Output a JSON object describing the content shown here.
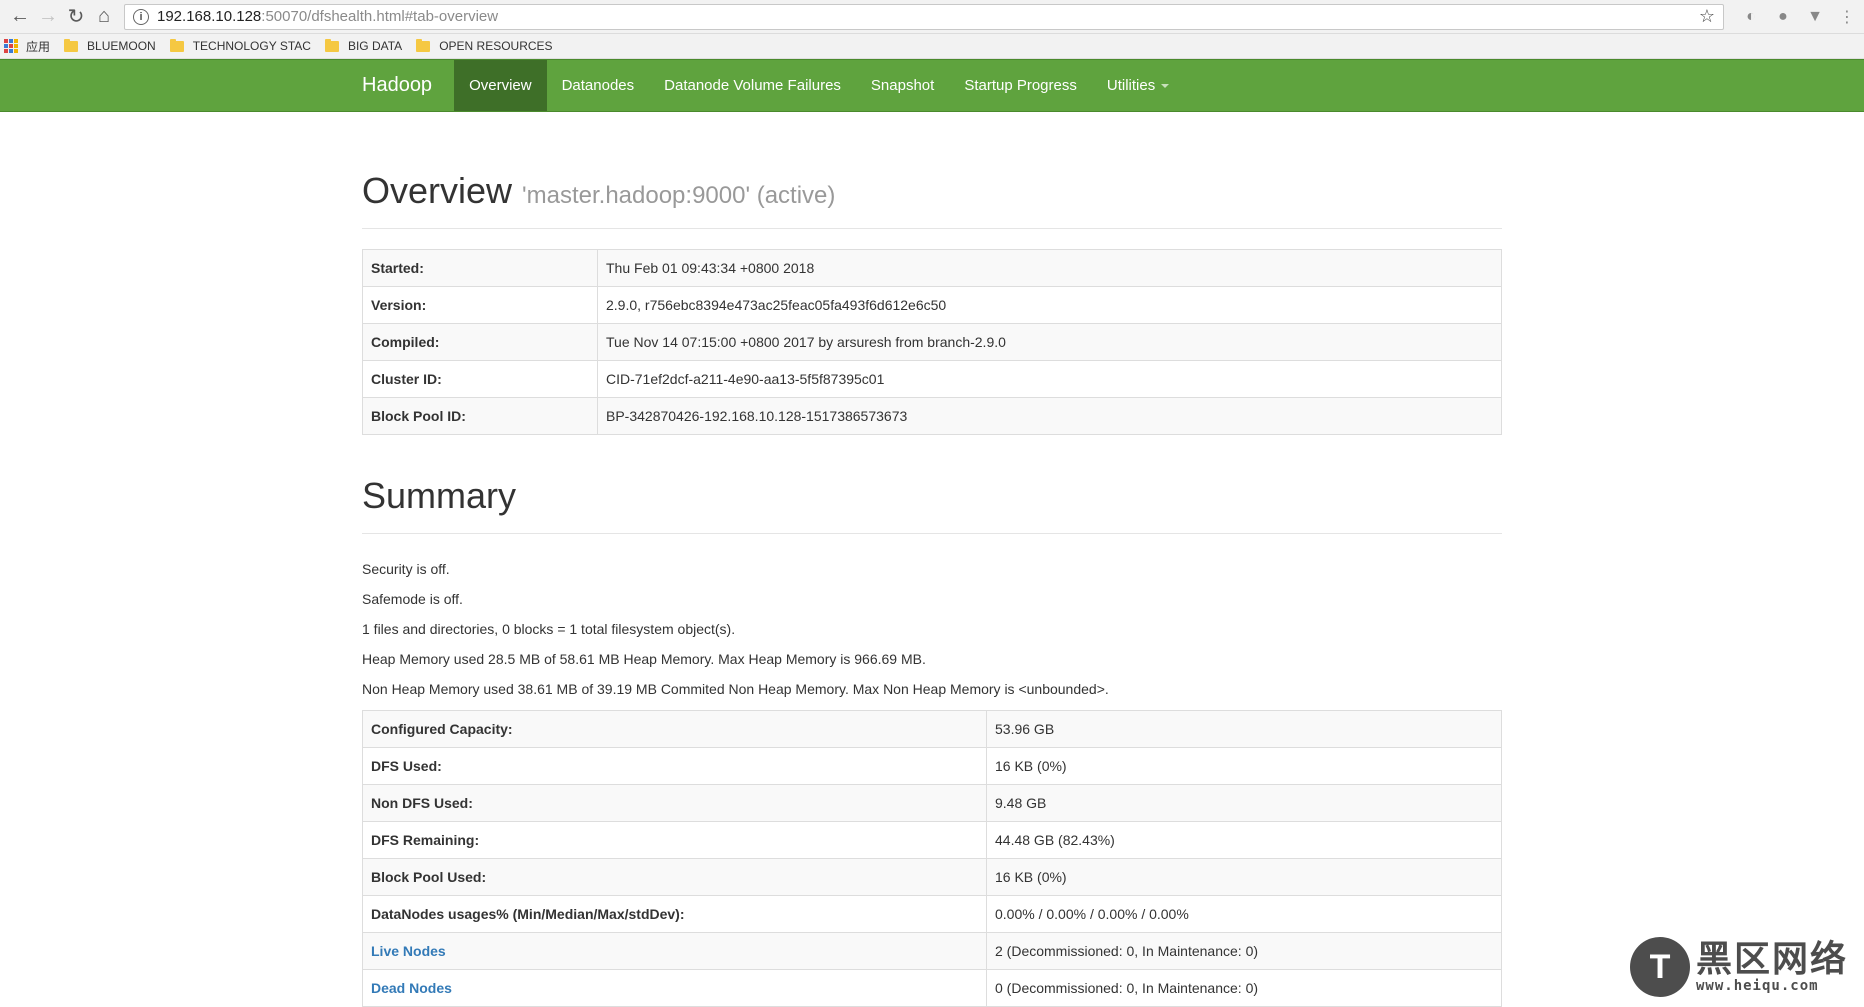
{
  "browser": {
    "url_host": "192.168.10.128",
    "url_path": ":50070/dfshealth.html#tab-overview",
    "bookmarks": [
      {
        "label": "应用",
        "type": "apps"
      },
      {
        "label": "BLUEMOON",
        "type": "folder"
      },
      {
        "label": "TECHNOLOGY STAC",
        "type": "folder"
      },
      {
        "label": "BIG DATA",
        "type": "folder"
      },
      {
        "label": "OPEN RESOURCES",
        "type": "folder"
      }
    ]
  },
  "navbar": {
    "brand": "Hadoop",
    "items": [
      "Overview",
      "Datanodes",
      "Datanode Volume Failures",
      "Snapshot",
      "Startup Progress",
      "Utilities"
    ],
    "active": "Overview",
    "accent_color": "#5fa33e",
    "active_color": "#3e6f28"
  },
  "overview": {
    "title": "Overview",
    "subtitle": "'master.hadoop:9000' (active)",
    "rows": [
      {
        "key": "Started:",
        "value": "Thu Feb 01 09:43:34 +0800 2018"
      },
      {
        "key": "Version:",
        "value": "2.9.0, r756ebc8394e473ac25feac05fa493f6d612e6c50"
      },
      {
        "key": "Compiled:",
        "value": "Tue Nov 14 07:15:00 +0800 2017 by arsuresh from branch-2.9.0"
      },
      {
        "key": "Cluster ID:",
        "value": "CID-71ef2dcf-a211-4e90-aa13-5f5f87395c01"
      },
      {
        "key": "Block Pool ID:",
        "value": "BP-342870426-192.168.10.128-1517386573673"
      }
    ]
  },
  "summary": {
    "title": "Summary",
    "lines": [
      "Security is off.",
      "Safemode is off.",
      "1 files and directories, 0 blocks = 1 total filesystem object(s).",
      "Heap Memory used 28.5 MB of 58.61 MB Heap Memory. Max Heap Memory is 966.69 MB.",
      "Non Heap Memory used 38.61 MB of 39.19 MB Commited Non Heap Memory. Max Non Heap Memory is <unbounded>."
    ],
    "rows": [
      {
        "key": "Configured Capacity:",
        "value": "53.96 GB"
      },
      {
        "key": "DFS Used:",
        "value": "16 KB (0%)"
      },
      {
        "key": "Non DFS Used:",
        "value": "9.48 GB"
      },
      {
        "key": "DFS Remaining:",
        "value": "44.48 GB (82.43%)"
      },
      {
        "key": "Block Pool Used:",
        "value": "16 KB (0%)"
      },
      {
        "key": "DataNodes usages% (Min/Median/Max/stdDev):",
        "value": "0.00% / 0.00% / 0.00% / 0.00%"
      },
      {
        "key": "Live Nodes",
        "value": "2 (Decommissioned: 0, In Maintenance: 0)",
        "link": true
      },
      {
        "key": "Dead Nodes",
        "value": "0 (Decommissioned: 0, In Maintenance: 0)",
        "link": true
      }
    ]
  },
  "watermark": {
    "glyph": "T",
    "title": "黑区网络",
    "url": "www.heiqu.com"
  }
}
